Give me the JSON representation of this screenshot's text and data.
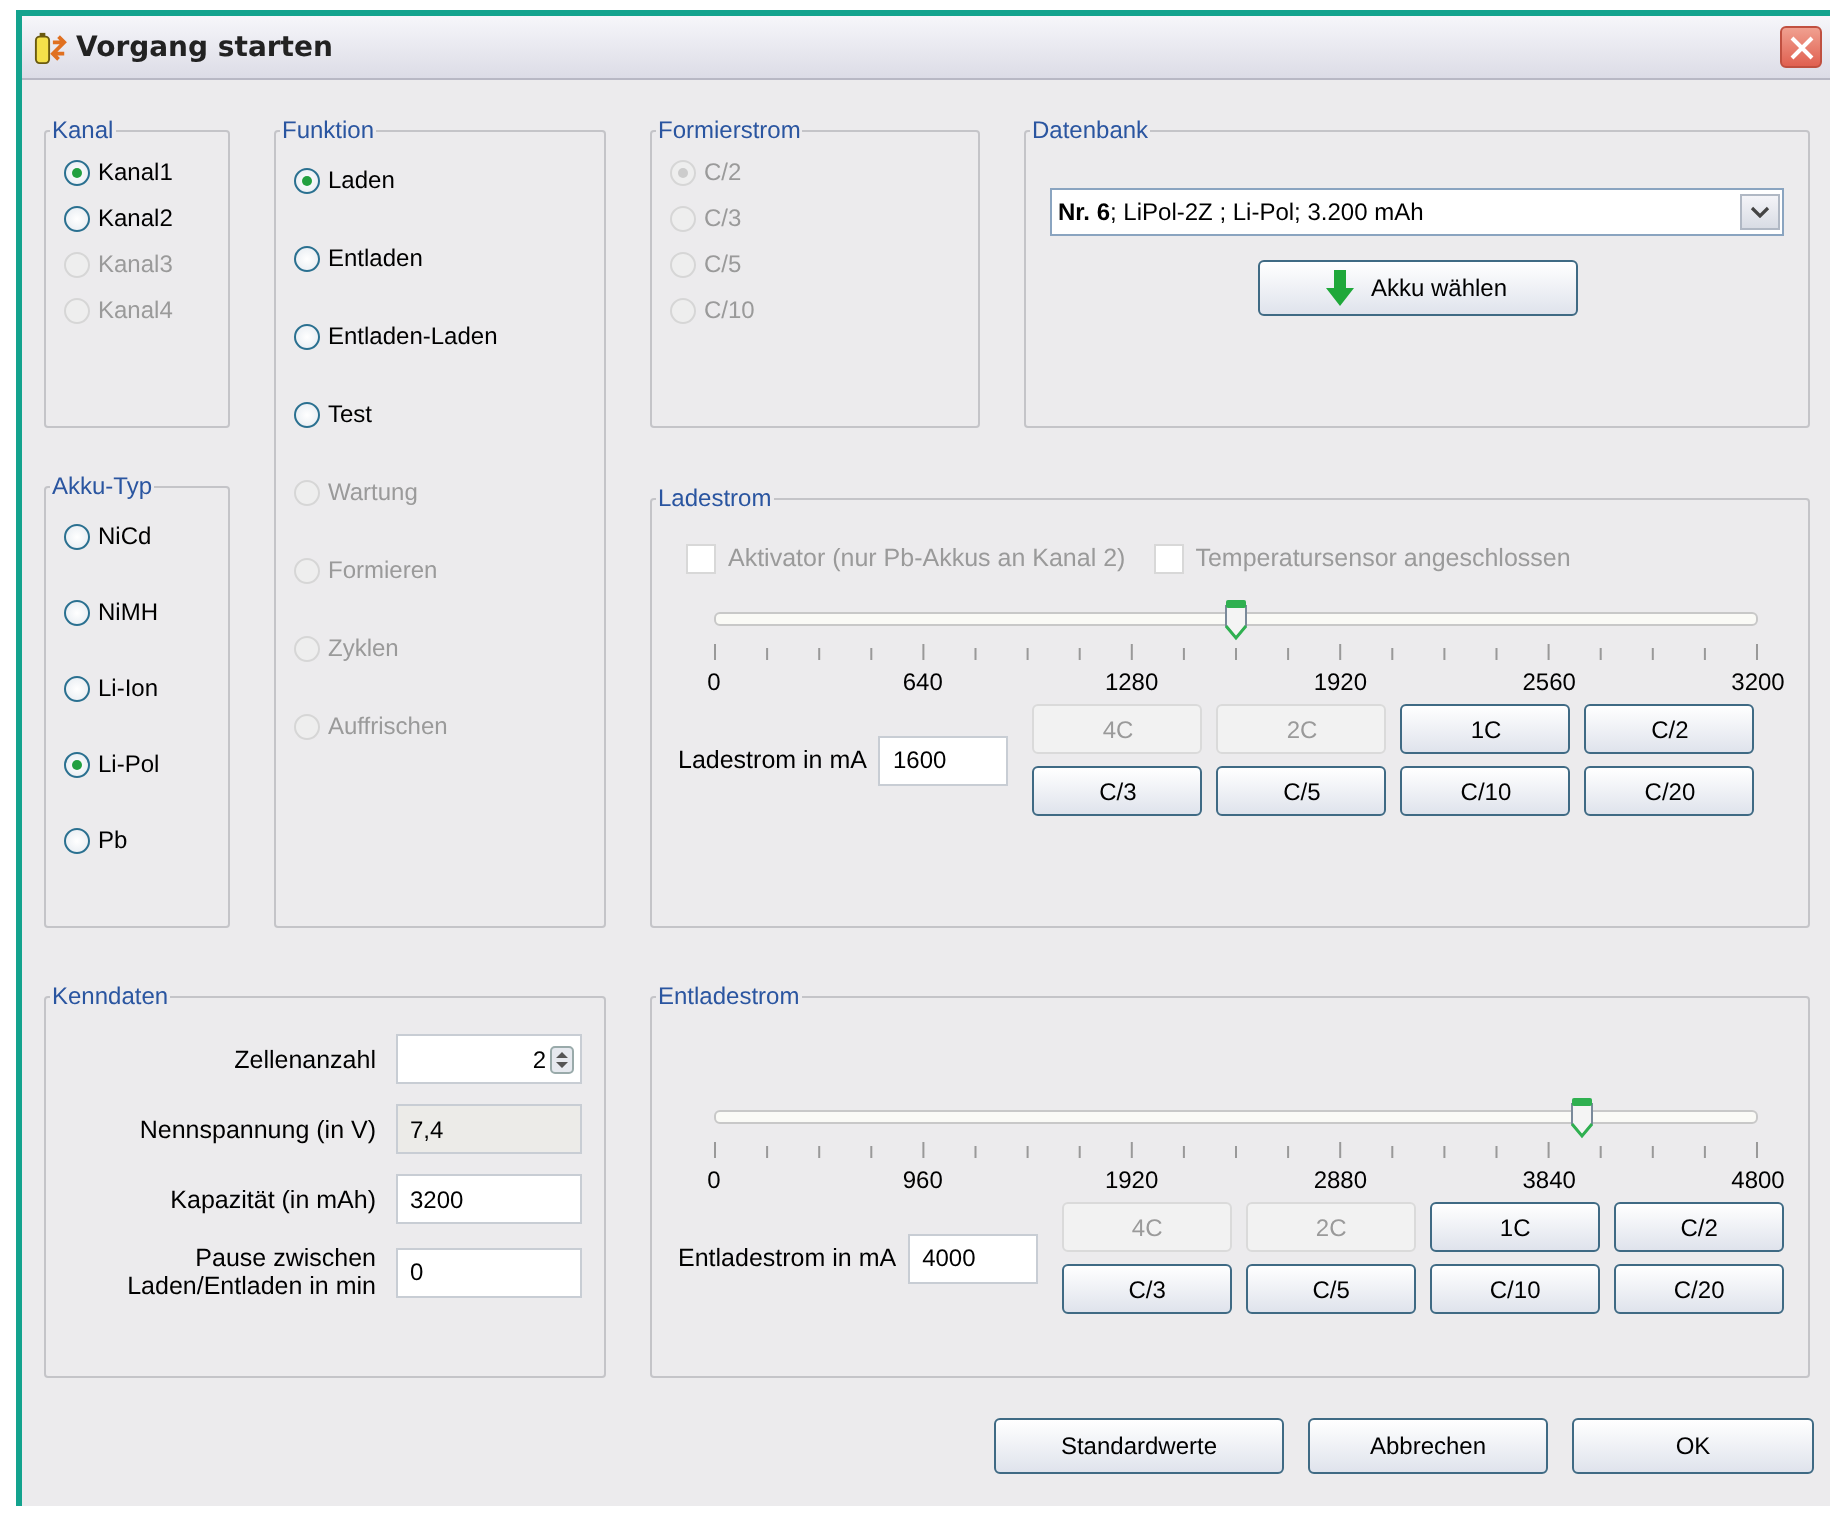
{
  "window": {
    "title": "Vorgang starten"
  },
  "kanal": {
    "title": "Kanal",
    "items": [
      {
        "label": "Kanal1",
        "selected": true,
        "disabled": false
      },
      {
        "label": "Kanal2",
        "selected": false,
        "disabled": false
      },
      {
        "label": "Kanal3",
        "selected": false,
        "disabled": true
      },
      {
        "label": "Kanal4",
        "selected": false,
        "disabled": true
      }
    ]
  },
  "funktion": {
    "title": "Funktion",
    "items": [
      {
        "label": "Laden",
        "selected": true,
        "disabled": false
      },
      {
        "label": "Entladen",
        "selected": false,
        "disabled": false
      },
      {
        "label": "Entladen-Laden",
        "selected": false,
        "disabled": false
      },
      {
        "label": "Test",
        "selected": false,
        "disabled": false
      },
      {
        "label": "Wartung",
        "selected": false,
        "disabled": true
      },
      {
        "label": "Formieren",
        "selected": false,
        "disabled": true
      },
      {
        "label": "Zyklen",
        "selected": false,
        "disabled": true
      },
      {
        "label": "Auffrischen",
        "selected": false,
        "disabled": true
      }
    ]
  },
  "akku_typ": {
    "title": "Akku-Typ",
    "items": [
      {
        "label": "NiCd",
        "selected": false,
        "disabled": false
      },
      {
        "label": "NiMH",
        "selected": false,
        "disabled": false
      },
      {
        "label": "Li-Ion",
        "selected": false,
        "disabled": false
      },
      {
        "label": "Li-Pol",
        "selected": true,
        "disabled": false
      },
      {
        "label": "Pb",
        "selected": false,
        "disabled": false
      }
    ]
  },
  "formierstrom": {
    "title": "Formierstrom",
    "items": [
      {
        "label": "C/2",
        "selected": true,
        "disabled": true
      },
      {
        "label": "C/3",
        "selected": false,
        "disabled": true
      },
      {
        "label": "C/5",
        "selected": false,
        "disabled": true
      },
      {
        "label": "C/10",
        "selected": false,
        "disabled": true
      }
    ]
  },
  "datenbank": {
    "title": "Datenbank",
    "combo_value": "**Nr. 6**; LiPol-2Z ; Li-Pol; 3.200 mAh",
    "button": {
      "label": "Akku wählen"
    }
  },
  "ladestrom": {
    "title": "Ladestrom",
    "checkboxes": [
      {
        "label": "Aktivator (nur Pb-Akkus an Kanal 2)",
        "checked": false,
        "disabled": true
      },
      {
        "label": "Temperatursensor angeschlossen",
        "checked": false,
        "disabled": true
      }
    ],
    "slider": {
      "level": 0.5,
      "scale": [
        "0",
        "640",
        "1280",
        "1920",
        "2560",
        "3200"
      ]
    },
    "field_label": "Ladestrom in mA",
    "value": "1600",
    "buttons": [
      {
        "label": "4C",
        "disabled": true
      },
      {
        "label": "2C",
        "disabled": true
      },
      {
        "label": "1C",
        "disabled": false
      },
      {
        "label": "C/2",
        "disabled": false
      },
      {
        "label": "C/3",
        "disabled": false
      },
      {
        "label": "C/5",
        "disabled": false
      },
      {
        "label": "C/10",
        "disabled": false
      },
      {
        "label": "C/20",
        "disabled": false
      }
    ]
  },
  "kenndaten": {
    "title": "Kenndaten",
    "rows": [
      {
        "label": "Zellenanzahl",
        "value": "2",
        "kind": "spin"
      },
      {
        "label": "Nennspannung (in V)",
        "value": "7,4",
        "kind": "readonly"
      },
      {
        "label": "Kapazität (in mAh)",
        "value": "3200",
        "kind": "field"
      },
      {
        "label": "Pause zwischen Laden/Entladen in min",
        "value": "0",
        "kind": "field"
      }
    ]
  },
  "entladestrom": {
    "title": "Entladestrom",
    "slider": {
      "level": 0.833,
      "scale": [
        "0",
        "960",
        "1920",
        "2880",
        "3840",
        "4800"
      ]
    },
    "field_label": "Entladestrom in mA",
    "value": "4000",
    "buttons": [
      {
        "label": "4C",
        "disabled": true
      },
      {
        "label": "2C",
        "disabled": true
      },
      {
        "label": "1C",
        "disabled": false
      },
      {
        "label": "C/2",
        "disabled": false
      },
      {
        "label": "C/3",
        "disabled": false
      },
      {
        "label": "C/5",
        "disabled": false
      },
      {
        "label": "C/10",
        "disabled": false
      },
      {
        "label": "C/20",
        "disabled": false
      }
    ]
  },
  "footer_buttons": [
    {
      "label": "Standardwerte"
    },
    {
      "label": "Abbrechen"
    },
    {
      "label": "OK"
    }
  ]
}
